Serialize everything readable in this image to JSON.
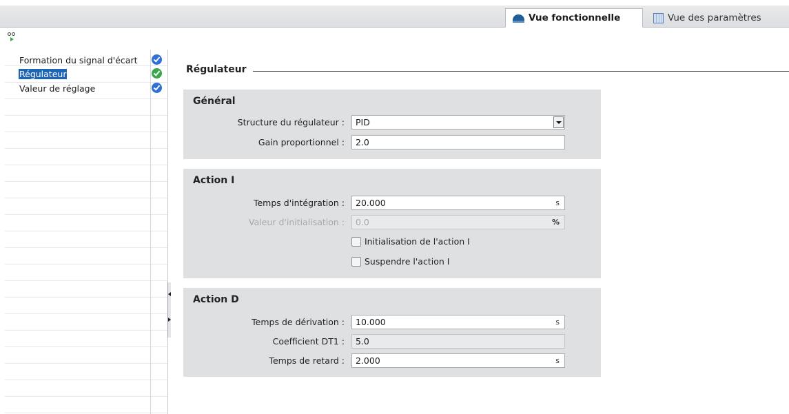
{
  "tabs": {
    "functional_view": "Vue fonctionnelle",
    "parameter_view": "Vue des paramètres"
  },
  "icons": {
    "functional_view": "functional-view-icon",
    "parameter_view": "parameter-view-icon",
    "toolbar": "pid-tool-icon",
    "status_ok": "check-circle-icon"
  },
  "colors": {
    "selection": "#1e64b4",
    "check_blue": "#2f6fd6",
    "check_green": "#39a84a"
  },
  "nav": {
    "items": [
      {
        "label": "Formation du signal d'écart",
        "status": "blue"
      },
      {
        "label": "Régulateur",
        "status": "green",
        "selected": true
      },
      {
        "label": "Valeur de réglage",
        "status": "blue"
      }
    ]
  },
  "main": {
    "section_title": "Régulateur",
    "general": {
      "title": "Général",
      "structure_label": "Structure du régulateur :",
      "structure_value": "PID",
      "gain_label": "Gain proportionnel :",
      "gain_value": "2.0"
    },
    "action_i": {
      "title": "Action I",
      "integration_label": "Temps d'intégration :",
      "integration_value": "20.000",
      "integration_unit": "s",
      "init_value_label": "Valeur d'initialisation :",
      "init_value_value": "0.0",
      "init_value_unit": "%",
      "init_checkbox_label": "Initialisation de l'action I",
      "suspend_checkbox_label": "Suspendre l'action I"
    },
    "action_d": {
      "title": "Action D",
      "derivation_label": "Temps de dérivation :",
      "derivation_value": "10.000",
      "derivation_unit": "s",
      "dt1_label": "Coefficient DT1 :",
      "dt1_value": "5.0",
      "delay_label": "Temps de retard :",
      "delay_value": "2.000",
      "delay_unit": "s"
    }
  }
}
